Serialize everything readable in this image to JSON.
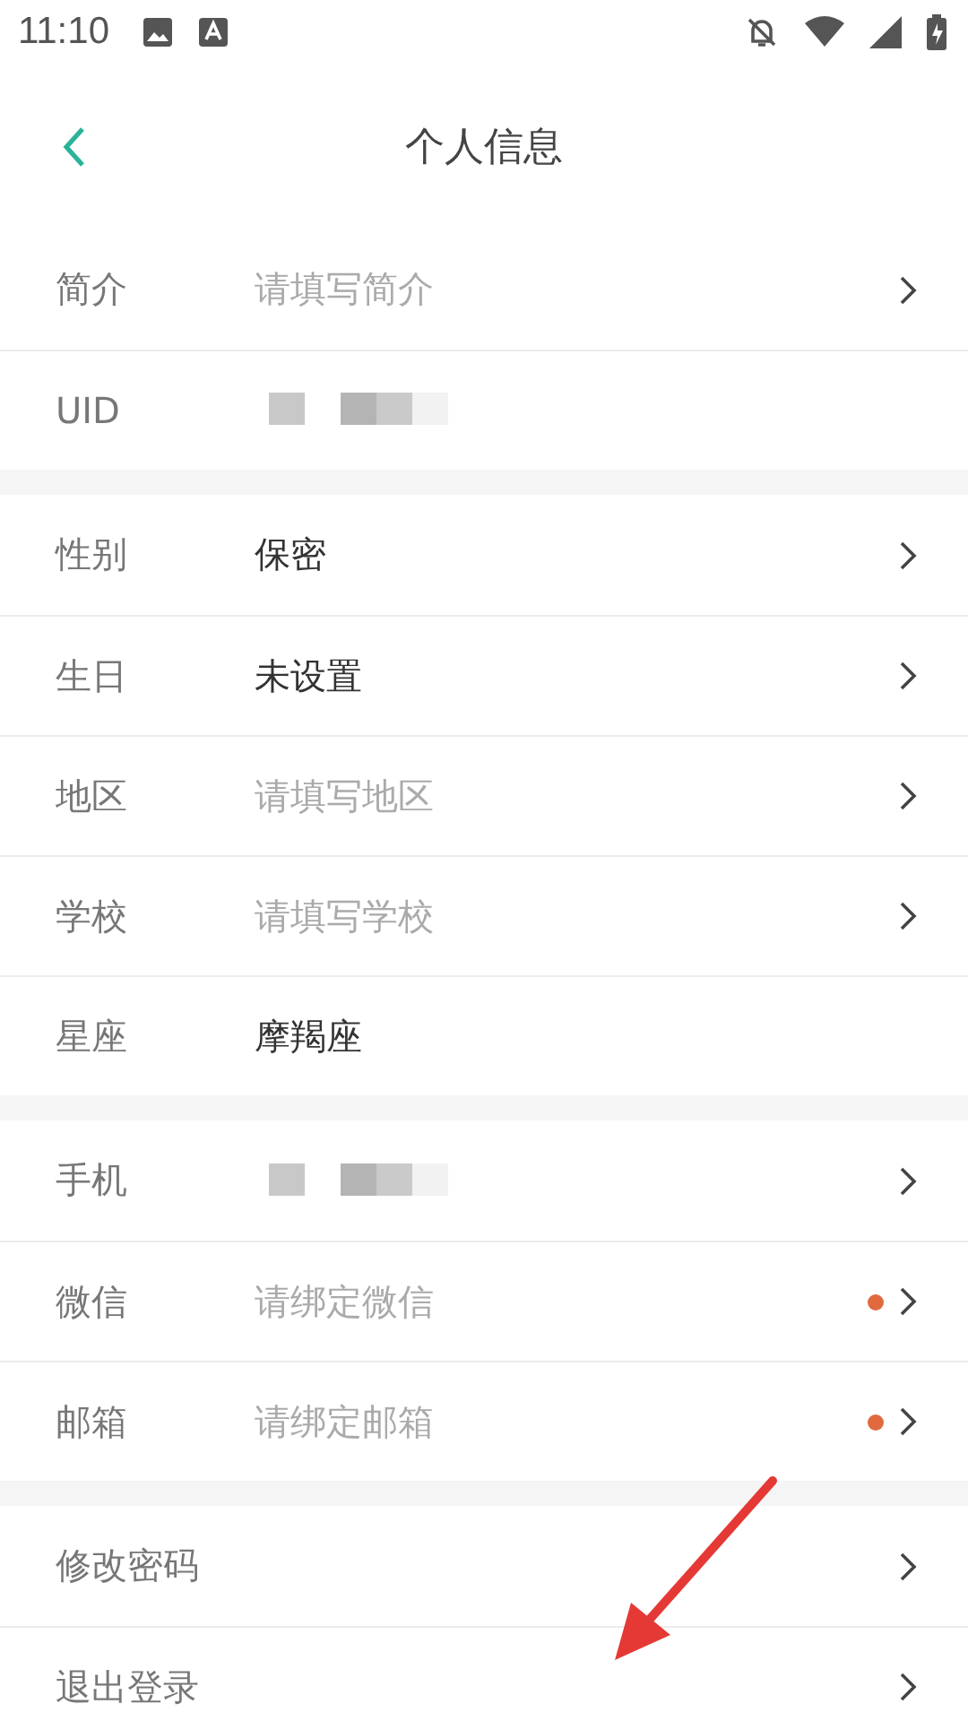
{
  "status_bar": {
    "time": "11:10"
  },
  "header": {
    "title": "个人信息"
  },
  "sections": [
    {
      "rows": [
        {
          "label": "简介",
          "kind": "placeholder",
          "text": "请填写简介",
          "chevron": true,
          "dot": false
        },
        {
          "label": "UID",
          "kind": "redacted",
          "chevron": false,
          "dot": false
        }
      ]
    },
    {
      "rows": [
        {
          "label": "性别",
          "kind": "value",
          "text": "保密",
          "chevron": true,
          "dot": false
        },
        {
          "label": "生日",
          "kind": "value",
          "text": "未设置",
          "chevron": true,
          "dot": false
        },
        {
          "label": "地区",
          "kind": "placeholder",
          "text": "请填写地区",
          "chevron": true,
          "dot": false
        },
        {
          "label": "学校",
          "kind": "placeholder",
          "text": "请填写学校",
          "chevron": true,
          "dot": false
        },
        {
          "label": "星座",
          "kind": "value",
          "text": "摩羯座",
          "chevron": false,
          "dot": false
        }
      ]
    },
    {
      "rows": [
        {
          "label": "手机",
          "kind": "redacted",
          "chevron": true,
          "dot": false
        },
        {
          "label": "微信",
          "kind": "placeholder",
          "text": "请绑定微信",
          "chevron": true,
          "dot": true
        },
        {
          "label": "邮箱",
          "kind": "placeholder",
          "text": "请绑定邮箱",
          "chevron": true,
          "dot": true
        }
      ]
    },
    {
      "rows": [
        {
          "label": "修改密码",
          "kind": "none",
          "chevron": true,
          "dot": false
        },
        {
          "label": "退出登录",
          "kind": "none",
          "chevron": true,
          "dot": false
        }
      ]
    }
  ]
}
